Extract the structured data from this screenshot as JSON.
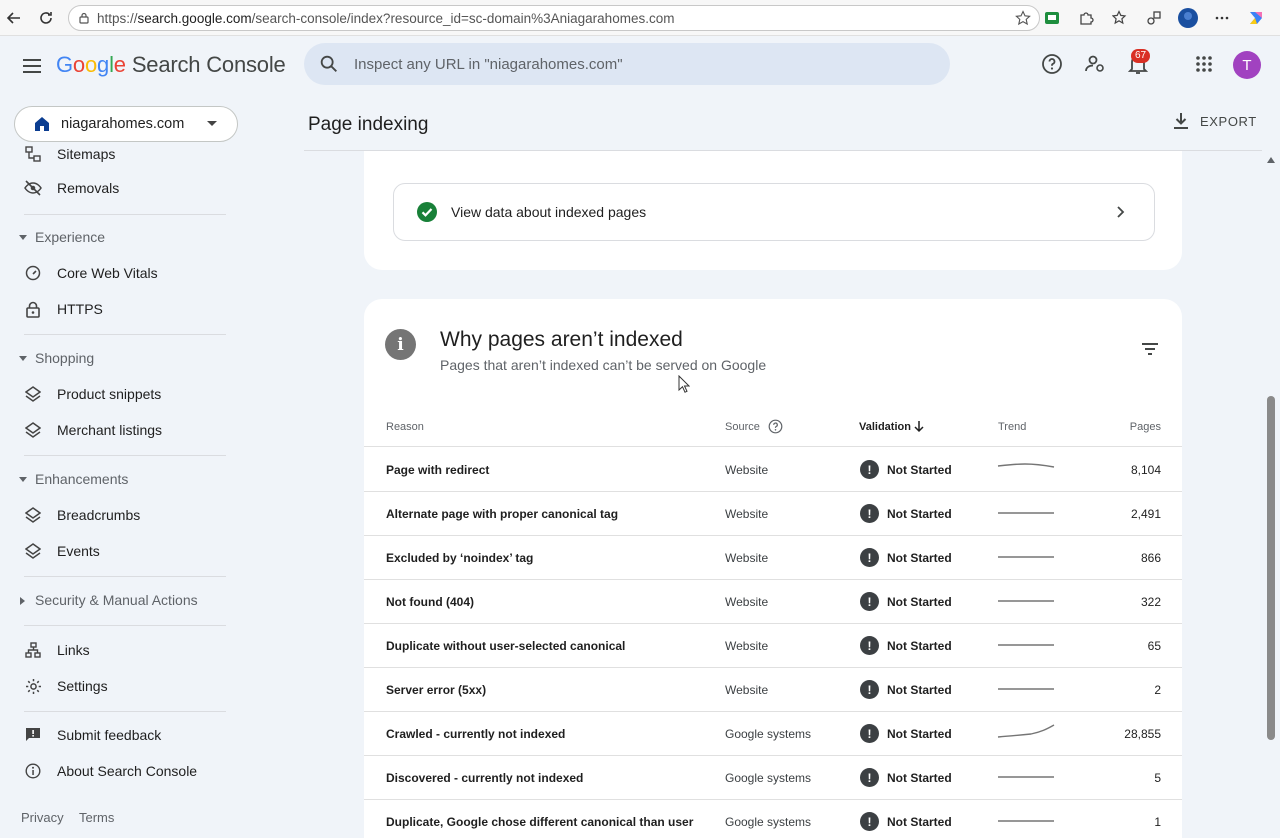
{
  "browser": {
    "url_prefix": "https://",
    "url_host": "search.google.com",
    "url_path": "/search-console/index?resource_id=sc-domain%3Aniagarahomes.com"
  },
  "header": {
    "logo_letters": [
      "G",
      "o",
      "o",
      "g",
      "l",
      "e"
    ],
    "product_name": "Search Console",
    "search_placeholder": "Inspect any URL in \"niagarahomes.com\"",
    "notification_count": "67",
    "avatar_initial": "T"
  },
  "sidebar": {
    "property_name": "niagarahomes.com",
    "items": {
      "sitemaps": "Sitemaps",
      "removals": "Removals",
      "core_web_vitals": "Core Web Vitals",
      "https": "HTTPS",
      "product_snippets": "Product snippets",
      "merchant_listings": "Merchant listings",
      "breadcrumbs": "Breadcrumbs",
      "events": "Events",
      "links": "Links",
      "settings": "Settings",
      "submit_feedback": "Submit feedback",
      "about": "About Search Console"
    },
    "sections": {
      "experience": "Experience",
      "shopping": "Shopping",
      "enhancements": "Enhancements",
      "security": "Security & Manual Actions"
    },
    "footer": {
      "privacy": "Privacy",
      "terms": "Terms"
    }
  },
  "main": {
    "page_title": "Page indexing",
    "export_label": "EXPORT",
    "indexed_link": "View data about indexed pages",
    "why_title": "Why pages aren’t indexed",
    "why_subtitle": "Pages that aren’t indexed can’t be served on Google",
    "columns": {
      "reason": "Reason",
      "source": "Source",
      "validation": "Validation",
      "trend": "Trend",
      "pages": "Pages"
    },
    "rows": [
      {
        "reason": "Page with redirect",
        "source": "Website",
        "validation": "Not Started",
        "pages": "8,104",
        "trend": "bump"
      },
      {
        "reason": "Alternate page with proper canonical tag",
        "source": "Website",
        "validation": "Not Started",
        "pages": "2,491",
        "trend": "flat"
      },
      {
        "reason": "Excluded by ‘noindex’ tag",
        "source": "Website",
        "validation": "Not Started",
        "pages": "866",
        "trend": "flat"
      },
      {
        "reason": "Not found (404)",
        "source": "Website",
        "validation": "Not Started",
        "pages": "322",
        "trend": "flat"
      },
      {
        "reason": "Duplicate without user-selected canonical",
        "source": "Website",
        "validation": "Not Started",
        "pages": "65",
        "trend": "flat"
      },
      {
        "reason": "Server error (5xx)",
        "source": "Website",
        "validation": "Not Started",
        "pages": "2",
        "trend": "flat"
      },
      {
        "reason": "Crawled - currently not indexed",
        "source": "Google systems",
        "validation": "Not Started",
        "pages": "28,855",
        "trend": "rising"
      },
      {
        "reason": "Discovered - currently not indexed",
        "source": "Google systems",
        "validation": "Not Started",
        "pages": "5",
        "trend": "flat"
      },
      {
        "reason": "Duplicate, Google chose different canonical than user",
        "source": "Google systems",
        "validation": "Not Started",
        "pages": "1",
        "trend": "flat"
      }
    ]
  },
  "colors": {
    "accent_blue": "#1a73e8",
    "success_green": "#188038",
    "page_bg": "#f0f4f9",
    "avatar_purple": "#a142c0",
    "badge_red": "#d93025"
  }
}
